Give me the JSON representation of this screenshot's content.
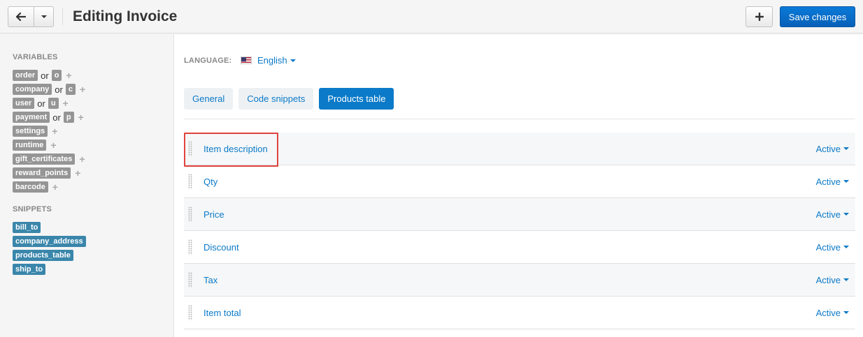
{
  "header": {
    "title": "Editing Invoice",
    "save_label": "Save changes",
    "back_icon": "arrow-left-icon",
    "add_icon": "plus-icon"
  },
  "sidebar": {
    "variables_heading": "VARIABLES",
    "variables": [
      {
        "name": "order",
        "alias": "o"
      },
      {
        "name": "company",
        "alias": "c"
      },
      {
        "name": "user",
        "alias": "u"
      },
      {
        "name": "payment",
        "alias": "p"
      },
      {
        "name": "settings",
        "alias": ""
      },
      {
        "name": "runtime",
        "alias": ""
      },
      {
        "name": "gift_certificates",
        "alias": ""
      },
      {
        "name": "reward_points",
        "alias": ""
      },
      {
        "name": "barcode",
        "alias": ""
      }
    ],
    "or_text": "or",
    "plus_text": "+",
    "snippets_heading": "SNIPPETS",
    "snippets": [
      "bill_to",
      "company_address",
      "products_table",
      "ship_to"
    ]
  },
  "language": {
    "label": "LANGUAGE:",
    "value": "English"
  },
  "tabs": [
    {
      "label": "General",
      "active": false
    },
    {
      "label": "Code snippets",
      "active": false
    },
    {
      "label": "Products table",
      "active": true
    }
  ],
  "products_table": {
    "rows": [
      {
        "name": "Item description",
        "status": "Active"
      },
      {
        "name": "Qty",
        "status": "Active"
      },
      {
        "name": "Price",
        "status": "Active"
      },
      {
        "name": "Discount",
        "status": "Active"
      },
      {
        "name": "Tax",
        "status": "Active"
      },
      {
        "name": "Item total",
        "status": "Active"
      }
    ]
  },
  "colors": {
    "accent": "#0b7ac8",
    "save_button": "#0760b8",
    "variable_tag": "#959595",
    "snippet_tag": "#3a86ab",
    "highlight": "#e0443e"
  }
}
